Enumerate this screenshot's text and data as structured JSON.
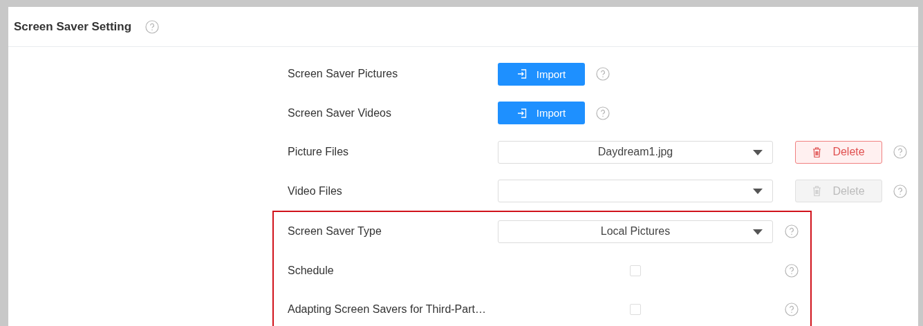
{
  "panel": {
    "title": "Screen Saver Setting"
  },
  "rows": [
    {
      "label": "Screen Saver Pictures",
      "kind": "import",
      "button": "Import",
      "highlighted": false
    },
    {
      "label": "Screen Saver Videos",
      "kind": "import",
      "button": "Import",
      "highlighted": false
    },
    {
      "label": "Picture Files",
      "kind": "file-select",
      "value": "Daydream1.jpg",
      "button": "Delete",
      "disabled": false,
      "highlighted": false
    },
    {
      "label": "Video Files",
      "kind": "file-select",
      "button": "Delete",
      "disabled": true,
      "highlighted": false
    },
    {
      "label": "Screen Saver Type",
      "kind": "select",
      "value": "Local Pictures",
      "highlighted": true
    },
    {
      "label": "Schedule",
      "kind": "checkbox",
      "checked": false,
      "highlighted": true
    },
    {
      "label": "Adapting Screen Savers for Third-Part…",
      "kind": "checkbox",
      "checked": false,
      "highlighted": true
    }
  ]
}
